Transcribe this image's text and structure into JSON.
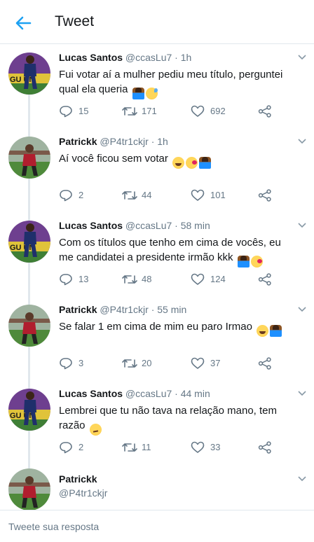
{
  "header": {
    "title": "Tweet"
  },
  "tweets": [
    {
      "name": "Lucas Santos",
      "meta": "@ccasLu7 · 1h",
      "text": "Fui votar aí a mulher pediu meu título, perguntei qual ela queria",
      "emojis": [
        "person-icon",
        "sweat-smile-icon"
      ],
      "avatar": "lucas",
      "counts": {
        "reply": "15",
        "retweet": "171",
        "like": "692"
      }
    },
    {
      "name": "Patrickk",
      "meta": "@P4tr1ckjr · 1h",
      "text": "Aí você ficou sem votar",
      "emojis": [
        "laugh-icon",
        "kiss-icon",
        "person-icon"
      ],
      "avatar": "patrick",
      "counts": {
        "reply": "2",
        "retweet": "44",
        "like": "101"
      }
    },
    {
      "name": "Lucas Santos",
      "meta": "@ccasLu7 · 58 min",
      "text": "Com os títulos que tenho em cima de vocês, eu me candidatei a presidente irmão kkk",
      "emojis": [
        "person-icon",
        "kiss-icon"
      ],
      "avatar": "lucas",
      "counts": {
        "reply": "13",
        "retweet": "48",
        "like": "124"
      }
    },
    {
      "name": "Patrickk",
      "meta": "@P4tr1ckjr · 55 min",
      "text": "Se falar 1 em cima de mim eu paro Irmao",
      "emojis": [
        "laugh-icon",
        "person-icon"
      ],
      "avatar": "patrick",
      "counts": {
        "reply": "3",
        "retweet": "20",
        "like": "37"
      }
    },
    {
      "name": "Lucas Santos",
      "meta": "@ccasLu7 · 44 min",
      "text": "Lembrei que tu não tava na relação mano, tem razão",
      "emojis": [
        "smirk-icon"
      ],
      "avatar": "lucas",
      "counts": {
        "reply": "2",
        "retweet": "11",
        "like": "33"
      }
    }
  ],
  "profile": {
    "name": "Patrickk",
    "handle": "@P4tr1ckjr"
  },
  "reply": {
    "placeholder": "Tweete sua resposta"
  },
  "colors": {
    "accent": "#1da1f2",
    "text": "#14171a",
    "muted": "#657786",
    "border": "#e1e8ed"
  }
}
